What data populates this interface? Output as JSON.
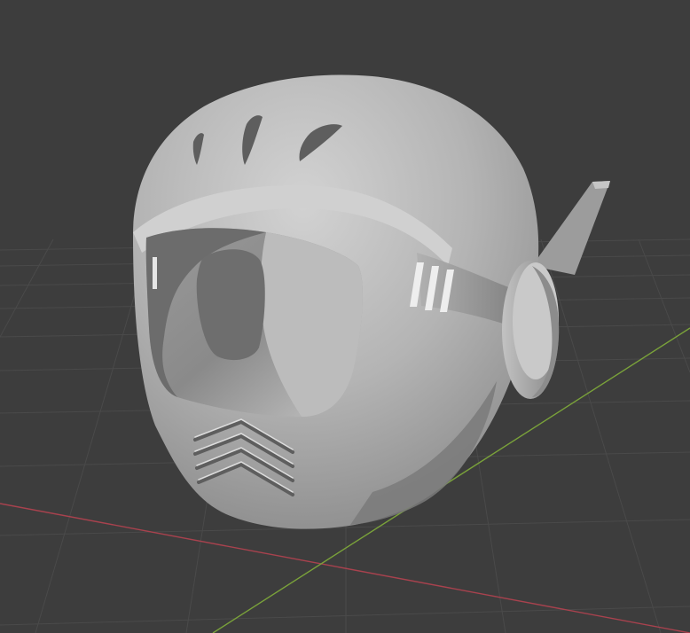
{
  "viewport": {
    "background_color": "#3d3d3d",
    "grid_line_color": "#4a4a4a",
    "x_axis_color": "#a8424e",
    "y_axis_color": "#7aa23a",
    "object": {
      "type": "helmet",
      "base_color": "#b5b5b5",
      "shadow_color": "#6f6f6f",
      "highlight_color": "#d4d4d4"
    }
  }
}
